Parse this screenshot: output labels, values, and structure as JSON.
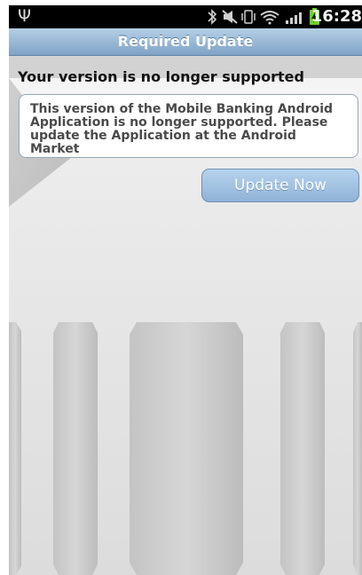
{
  "status_bar": {
    "time": "16:28",
    "icons": [
      "usb-icon",
      "bluetooth-icon",
      "mute-icon",
      "vibrate-icon",
      "wifi-icon",
      "signal-icon",
      "battery-charging-icon"
    ]
  },
  "title_bar": {
    "title": "Required Update"
  },
  "main": {
    "heading": "Your version is no longer supported",
    "message_lines": [
      "This version of the Mobile Banking Android",
      "Application is no longer supported. Please",
      "update the Application at the Android Market"
    ],
    "update_button_label": "Update Now"
  },
  "colors": {
    "status_bar_bg": "#000000",
    "title_bar_bg": "#8fb1d2",
    "button_bg": "#a3c3e2",
    "message_text": "#4a4a4a"
  }
}
